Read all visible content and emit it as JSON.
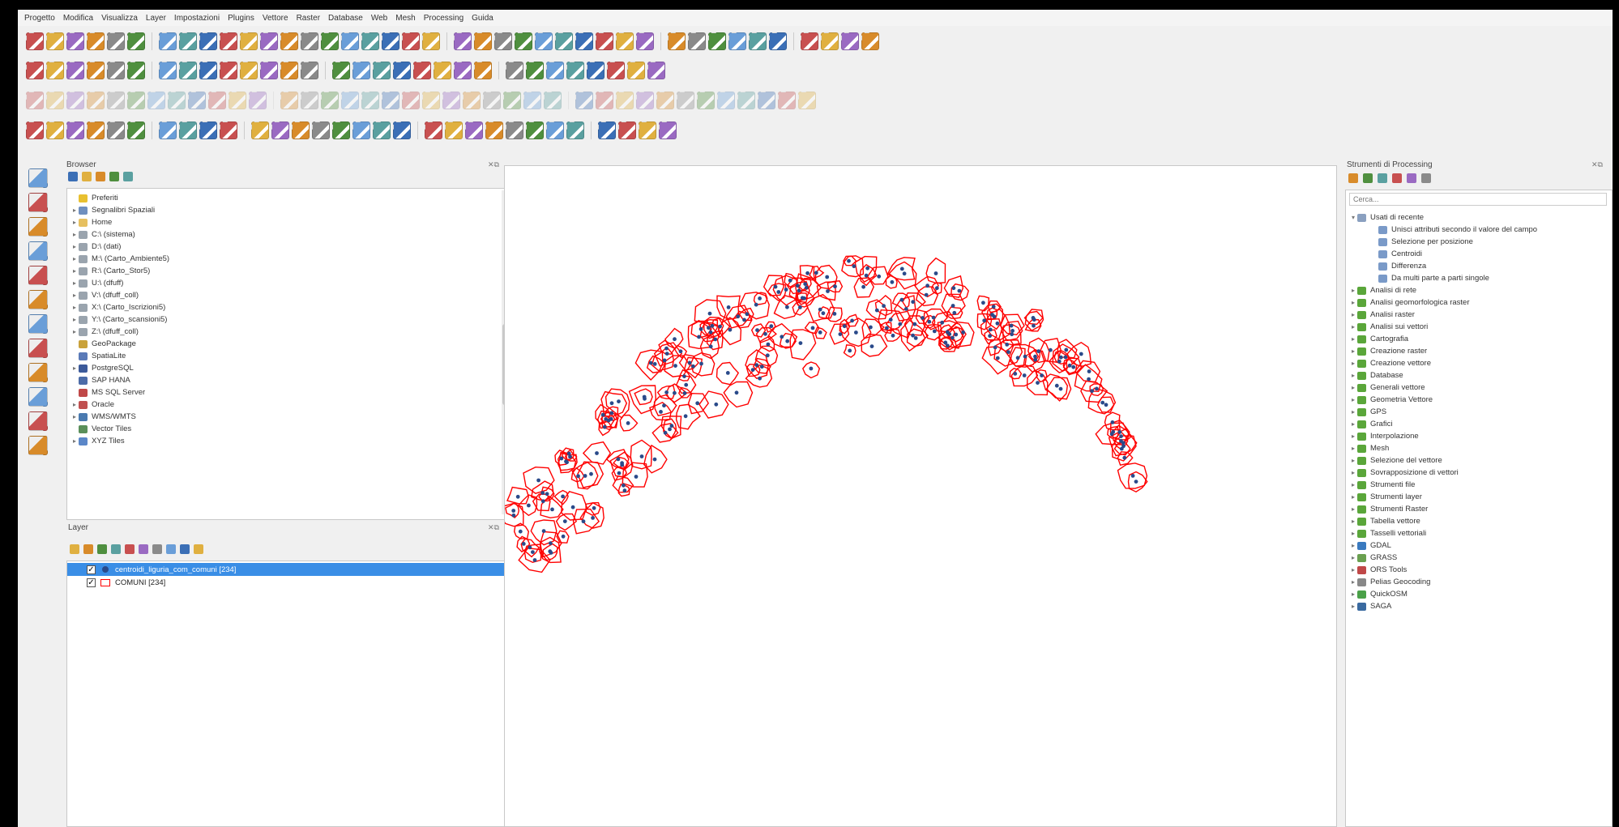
{
  "menu": [
    "Progetto",
    "Modifica",
    "Visualizza",
    "Layer",
    "Impostazioni",
    "Plugins",
    "Vettore",
    "Raster",
    "Database",
    "Web",
    "Mesh",
    "Processing",
    "Guida"
  ],
  "browser": {
    "title": "Browser",
    "items": [
      {
        "label": "Preferiti",
        "icon": "star-icon",
        "expand": ""
      },
      {
        "label": "Segnalibri Spaziali",
        "icon": "bookmark-icon",
        "expand": "▸"
      },
      {
        "label": "Home",
        "icon": "folder-icon",
        "expand": "▸"
      },
      {
        "label": "C:\\ (sistema)",
        "icon": "drive-icon",
        "expand": "▸"
      },
      {
        "label": "D:\\ (dati)",
        "icon": "drive-icon",
        "expand": "▸"
      },
      {
        "label": "M:\\ (Carto_Ambiente5)",
        "icon": "drive-icon",
        "expand": "▸"
      },
      {
        "label": "R:\\ (Carto_Stor5)",
        "icon": "drive-icon",
        "expand": "▸"
      },
      {
        "label": "U:\\ (dfuff)",
        "icon": "drive-icon",
        "expand": "▸"
      },
      {
        "label": "V:\\ (dfuff_coll)",
        "icon": "drive-icon",
        "expand": "▸"
      },
      {
        "label": "X:\\ (Carto_Iscrizioni5)",
        "icon": "drive-icon",
        "expand": "▸"
      },
      {
        "label": "Y:\\ (Carto_scansioni5)",
        "icon": "drive-icon",
        "expand": "▸"
      },
      {
        "label": "Z:\\ (dfuff_coll)",
        "icon": "drive-icon",
        "expand": "▸"
      },
      {
        "label": "GeoPackage",
        "icon": "geopackage-icon",
        "expand": ""
      },
      {
        "label": "SpatiaLite",
        "icon": "spatialite-icon",
        "expand": ""
      },
      {
        "label": "PostgreSQL",
        "icon": "postgresql-icon",
        "expand": "▸"
      },
      {
        "label": "SAP HANA",
        "icon": "hana-icon",
        "expand": ""
      },
      {
        "label": "MS SQL Server",
        "icon": "mssql-icon",
        "expand": ""
      },
      {
        "label": "Oracle",
        "icon": "oracle-icon",
        "expand": "▸"
      },
      {
        "label": "WMS/WMTS",
        "icon": "wms-icon",
        "expand": "▸"
      },
      {
        "label": "Vector Tiles",
        "icon": "vectortiles-icon",
        "expand": ""
      },
      {
        "label": "XYZ Tiles",
        "icon": "xyz-icon",
        "expand": "▸"
      }
    ]
  },
  "layers": {
    "title": "Layer",
    "items": [
      {
        "label": "centroidi_liguria_com_comuni [234]",
        "checked": true,
        "selected": true
      },
      {
        "label": "COMUNI [234]",
        "checked": true,
        "selected": false
      }
    ]
  },
  "processing": {
    "title": "Strumenti di Processing",
    "search_placeholder": "Cerca...",
    "recent_title": "Usati di recente",
    "recent": [
      "Unisci attributi secondo il valore del campo",
      "Selezione per posizione",
      "Centroidi",
      "Differenza",
      "Da multi parte a parti singole"
    ],
    "groups": [
      "Analisi di rete",
      "Analisi geomorfologica raster",
      "Analisi raster",
      "Analisi sui vettori",
      "Cartografia",
      "Creazione raster",
      "Creazione vettore",
      "Database",
      "Generali vettore",
      "Geometria Vettore",
      "GPS",
      "Grafici",
      "Interpolazione",
      "Mesh",
      "Selezione del vettore",
      "Sovrapposizione di vettori",
      "Strumenti file",
      "Strumenti layer",
      "Strumenti Raster",
      "Tabella vettore",
      "Tasselli vettoriali"
    ],
    "providers": [
      "GDAL",
      "GRASS",
      "ORS Tools",
      "Pelias Geocoding",
      "QuickOSM",
      "SAGA"
    ]
  },
  "colors": {
    "selection": "#3a8ee6",
    "map_outline": "#ff0000",
    "centroid": "#2a4a8a"
  }
}
